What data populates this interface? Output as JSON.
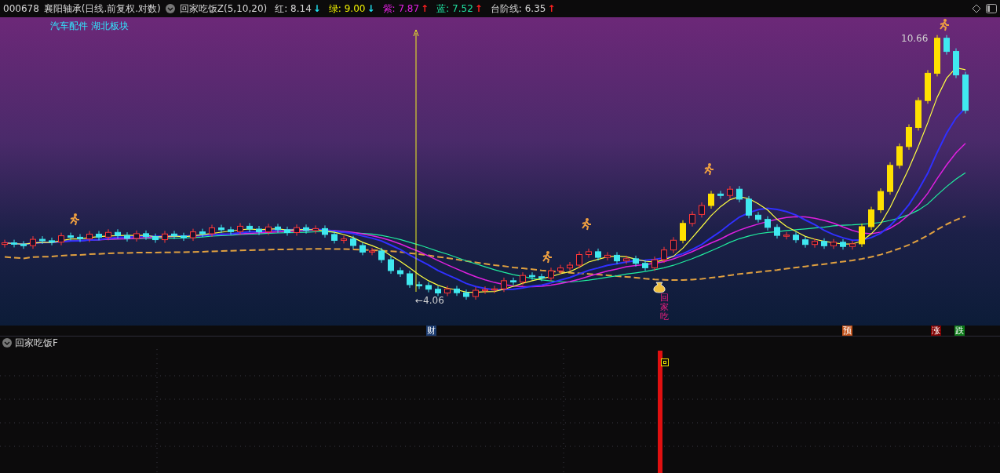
{
  "header": {
    "stock_code": "000678",
    "stock_title": "襄阳轴承(日线.前复权.对数)",
    "indicator_name": "回家吃饭Z(5,10,20)",
    "indicators": [
      {
        "label": "红:",
        "value": "8.14",
        "arrow": "↓",
        "rising": false,
        "color": "#d8d8d8"
      },
      {
        "label": "绿:",
        "value": "9.00",
        "arrow": "↓",
        "rising": false,
        "color": "#f0f000"
      },
      {
        "label": "紫:",
        "value": "7.87",
        "arrow": "↑",
        "rising": true,
        "color": "#e020e0"
      },
      {
        "label": "蓝:",
        "value": "7.52",
        "arrow": "↑",
        "rising": true,
        "color": "#20e0a0"
      },
      {
        "label": "台阶线:",
        "value": "6.35",
        "arrow": "↑",
        "rising": true,
        "color": "#d8d8d8"
      }
    ]
  },
  "main_chart": {
    "sector_tags": "汽车配件 湖北板块",
    "high_label": "10.66",
    "low_label": "←4.06",
    "signal_text": "回家吃"
  },
  "signal_strip": [
    {
      "label": "财",
      "color": "#1c3c70"
    },
    {
      "label": "预",
      "color": "#c05018"
    },
    {
      "label": "涨",
      "color": "#800000"
    },
    {
      "label": "跌",
      "color": "#0c7a18"
    }
  ],
  "lower_panel": {
    "title": "回家吃饭F"
  }
}
